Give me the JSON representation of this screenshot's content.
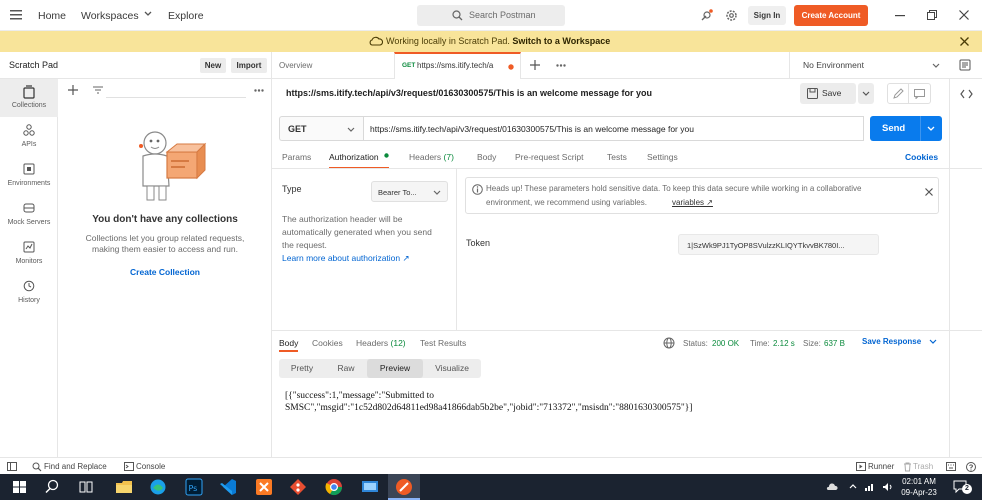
{
  "topbar": {
    "home": "Home",
    "workspaces": "Workspaces",
    "explore": "Explore",
    "search_placeholder": "Search Postman",
    "sign_in": "Sign In",
    "create_account": "Create Account"
  },
  "banner": {
    "text": "Working locally in Scratch Pad.",
    "link": "Switch to a Workspace"
  },
  "sidebar": {
    "title": "Scratch Pad",
    "new_label": "New",
    "import_label": "Import",
    "rail": [
      {
        "label": "Collections",
        "icon": "collections-icon"
      },
      {
        "label": "APIs",
        "icon": "apis-icon"
      },
      {
        "label": "Environments",
        "icon": "environments-icon"
      },
      {
        "label": "Mock Servers",
        "icon": "mock-servers-icon"
      },
      {
        "label": "Monitors",
        "icon": "monitors-icon"
      },
      {
        "label": "History",
        "icon": "history-icon"
      }
    ],
    "empty_title": "You don't have any collections",
    "empty_desc_1": "Collections let you group related requests,",
    "empty_desc_2": "making them easier to access and run.",
    "create_collection": "Create Collection"
  },
  "tabs": {
    "overview": "Overview",
    "active_method": "GET",
    "active_label": "https://sms.itify.tech/a",
    "environment": "No Environment"
  },
  "request": {
    "title": "https://sms.itify.tech/api/v3/request/01630300575/This is an welcome message for you",
    "save": "Save",
    "method": "GET",
    "url": "https://sms.itify.tech/api/v3/request/01630300575/This is an welcome message for you",
    "send": "Send",
    "subtabs": {
      "params": "Params",
      "authorization": "Authorization",
      "headers": "Headers",
      "headers_count": "(7)",
      "body": "Body",
      "prerequest": "Pre-request Script",
      "tests": "Tests",
      "settings": "Settings",
      "cookies": "Cookies"
    }
  },
  "auth": {
    "type_label": "Type",
    "type_value": "Bearer To...",
    "desc_1": "The authorization header will be",
    "desc_2": "automatically generated when you send",
    "desc_3": "the request.",
    "learn_more": "Learn more about authorization ↗",
    "notice_1": "Heads up! These parameters hold sensitive data. To keep this data secure while working in a collaborative",
    "notice_2": "environment, we recommend using variables.",
    "notice_link": "variables ↗",
    "token_label": "Token",
    "token_value": "1|SzWk9PJ1TyOP8SVulzzKLIQYTkvvBK780I..."
  },
  "response": {
    "tabs": {
      "body": "Body",
      "cookies": "Cookies",
      "headers": "Headers",
      "headers_count": "(12)",
      "test_results": "Test Results"
    },
    "status_label": "Status:",
    "status_value": "200 OK",
    "time_label": "Time:",
    "time_value": "2.12 s",
    "size_label": "Size:",
    "size_value": "637 B",
    "save_response": "Save Response",
    "views": {
      "pretty": "Pretty",
      "raw": "Raw",
      "preview": "Preview",
      "visualize": "Visualize"
    },
    "body_line1": "[{\"success\":1,\"message\":\"Submitted to",
    "body_line2": "SMSC\",\"msgid\":\"1c52d802d64811ed98a41866dab5b2be\",\"jobid\":\"713372\",\"msisdn\":\"8801630300575\"}]"
  },
  "statusbar": {
    "find_replace": "Find and Replace",
    "console": "Console",
    "runner": "Runner",
    "trash": "Trash"
  },
  "taskbar": {
    "time": "02:01 AM",
    "date": "09-Apr-23",
    "notif_count": "2"
  },
  "colors": {
    "accent_orange": "#ef5b25",
    "send_blue": "#097bed",
    "banner_yellow": "#f8e49a",
    "status_green": "#0a8a3c"
  }
}
